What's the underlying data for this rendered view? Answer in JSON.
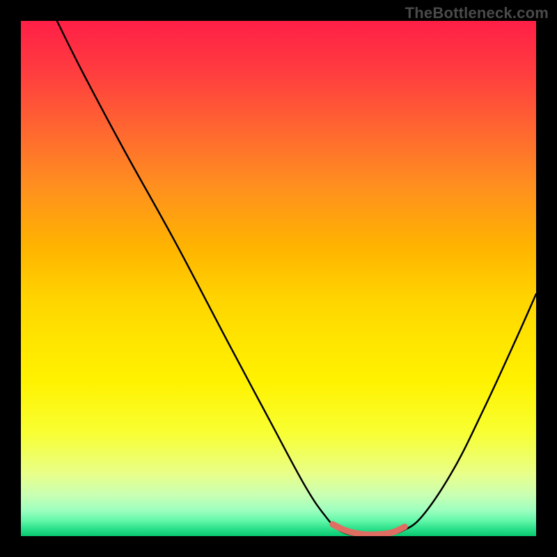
{
  "watermark": "TheBottleneck.com",
  "colors": {
    "background": "#000000",
    "gradient_top": "#ff1f47",
    "gradient_mid": "#ffe500",
    "gradient_bottom": "#08c96f",
    "curve": "#000000",
    "red_segment": "#e06d62"
  },
  "chart_data": {
    "type": "line",
    "title": "",
    "xlabel": "",
    "ylabel": "",
    "x_range": [
      0,
      100
    ],
    "y_range": [
      0,
      100
    ],
    "note": "Axes are unlabeled; values estimated from pixel positions (0–100 normalized).",
    "series": [
      {
        "name": "curve",
        "points": [
          {
            "x": 7,
            "y": 100
          },
          {
            "x": 12,
            "y": 90
          },
          {
            "x": 20,
            "y": 75
          },
          {
            "x": 30,
            "y": 57
          },
          {
            "x": 40,
            "y": 38
          },
          {
            "x": 48,
            "y": 23
          },
          {
            "x": 55,
            "y": 10
          },
          {
            "x": 59,
            "y": 4
          },
          {
            "x": 62,
            "y": 1
          },
          {
            "x": 66,
            "y": 0
          },
          {
            "x": 70,
            "y": 0
          },
          {
            "x": 74,
            "y": 1
          },
          {
            "x": 78,
            "y": 4
          },
          {
            "x": 84,
            "y": 13
          },
          {
            "x": 90,
            "y": 25
          },
          {
            "x": 96,
            "y": 38
          },
          {
            "x": 100,
            "y": 47
          }
        ]
      }
    ],
    "highlighted_segment": {
      "name": "red-bottom-segment",
      "color": "#e06d62",
      "stroke_width": 9,
      "points": [
        {
          "x": 60.5,
          "y": 2.3
        },
        {
          "x": 63,
          "y": 1.1
        },
        {
          "x": 66,
          "y": 0.4
        },
        {
          "x": 69,
          "y": 0.3
        },
        {
          "x": 72,
          "y": 0.7
        },
        {
          "x": 74.5,
          "y": 1.8
        }
      ]
    }
  }
}
